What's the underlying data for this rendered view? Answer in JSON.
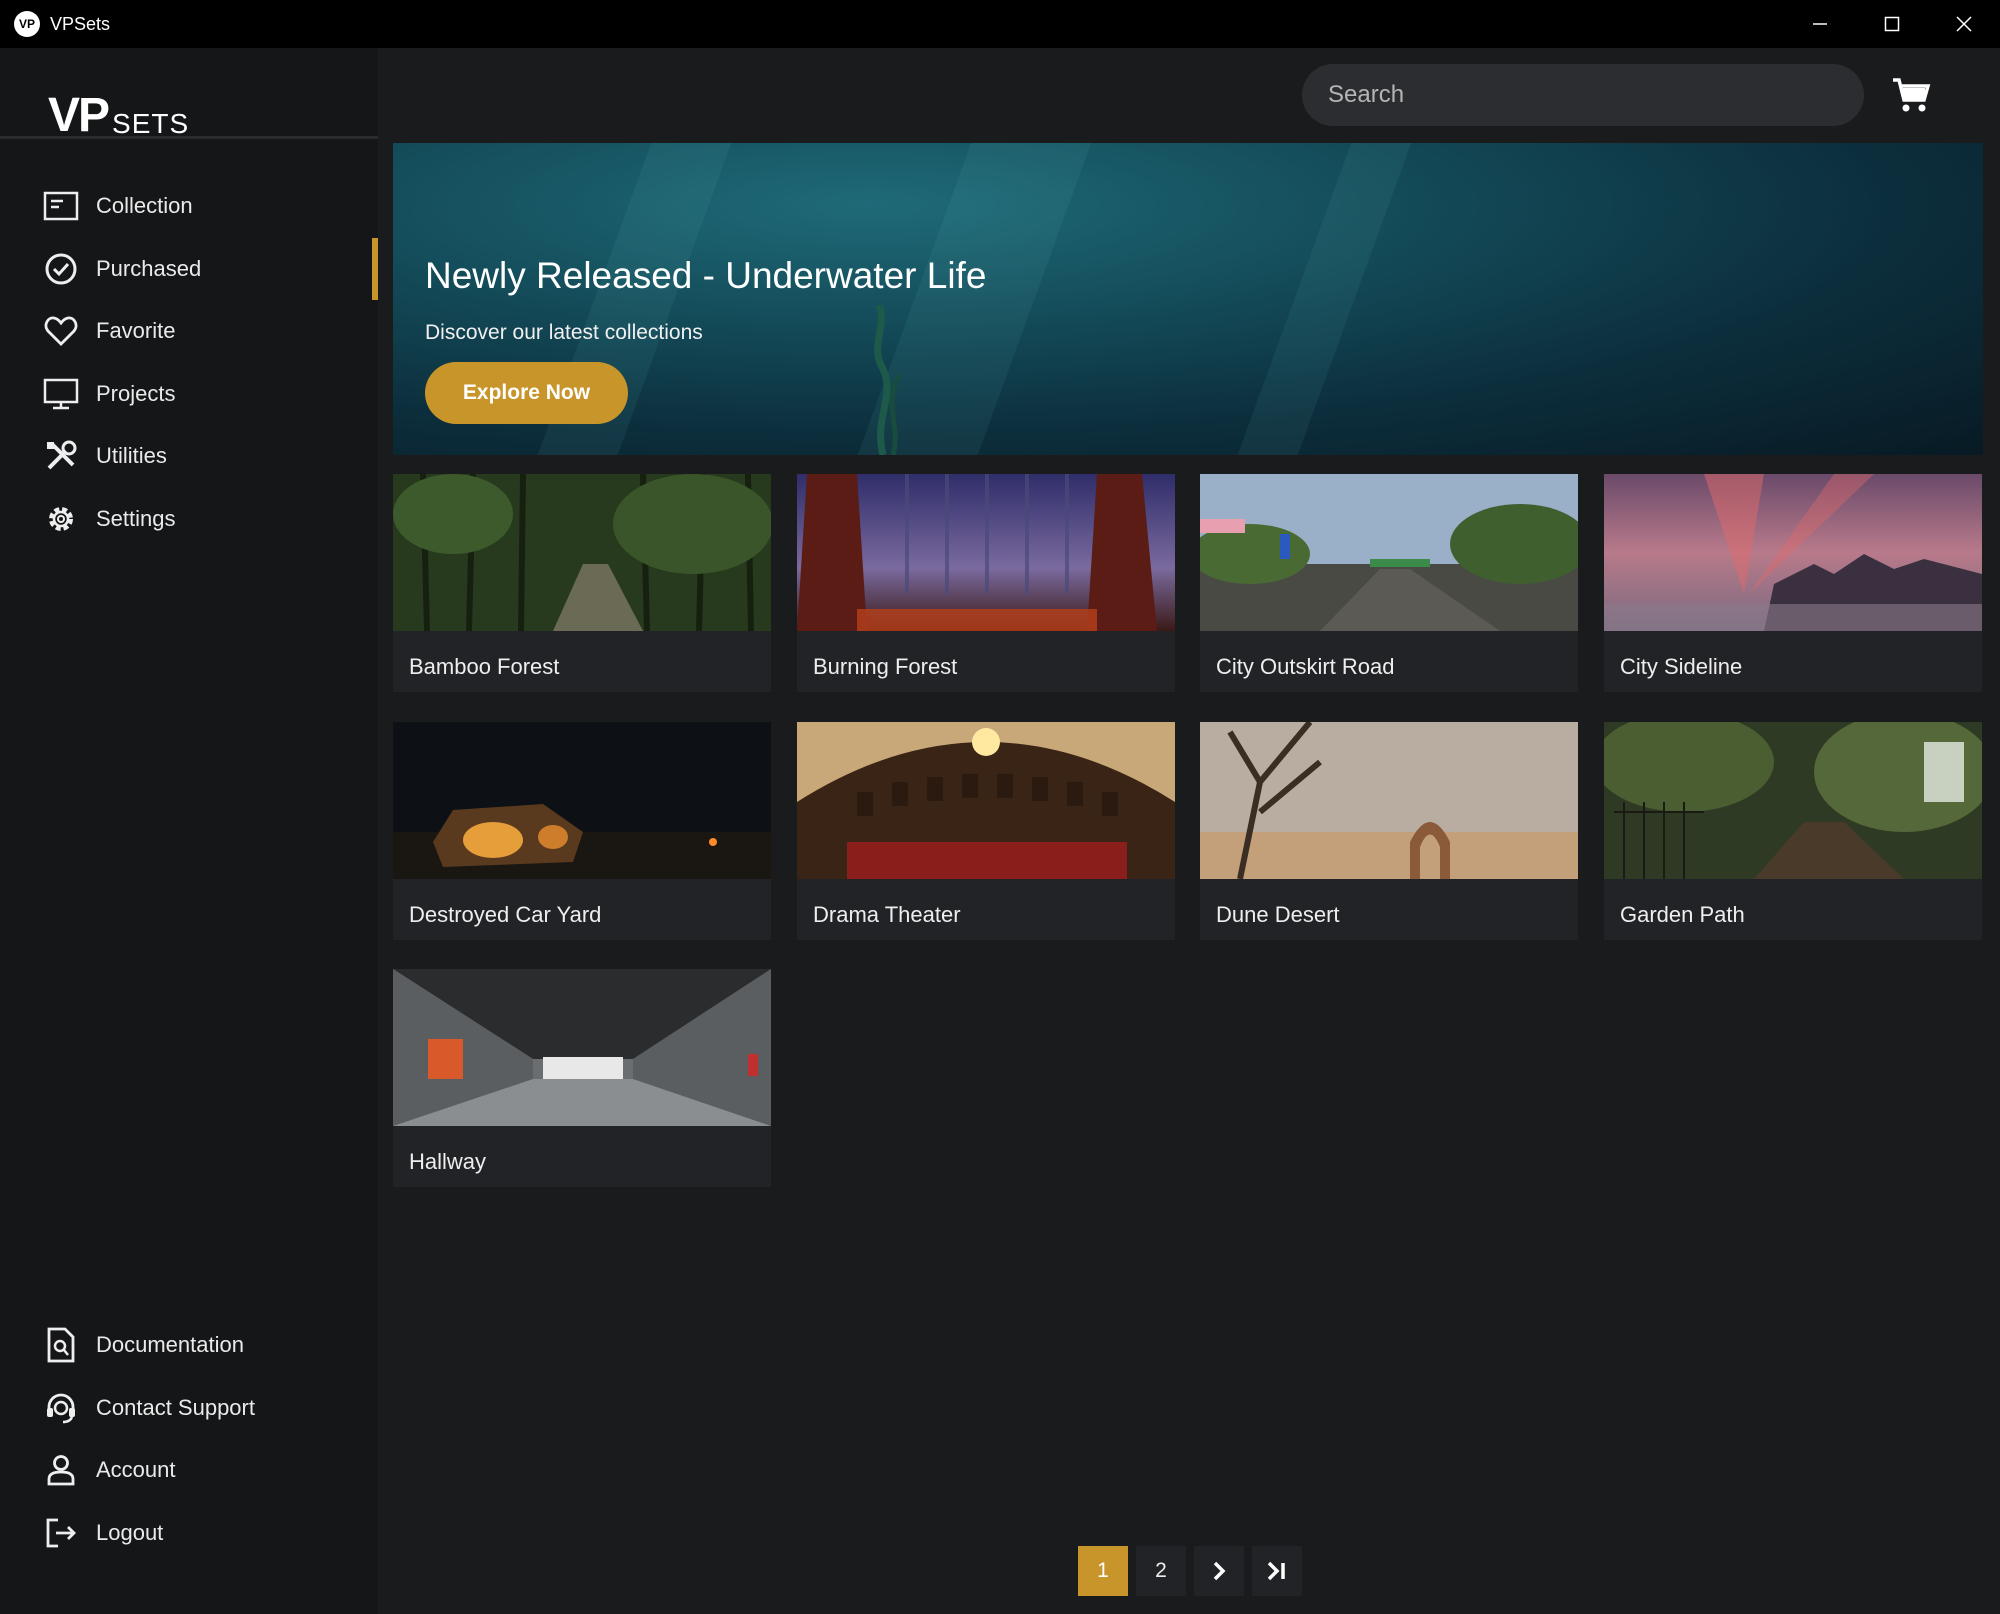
{
  "window": {
    "title": "VPSets",
    "icon_text": "VP"
  },
  "logo": {
    "main": "VP",
    "sub": "SETS"
  },
  "sidebar": {
    "items": [
      {
        "label": "Collection",
        "icon": "collection-icon"
      },
      {
        "label": "Purchased",
        "icon": "check-circle-icon",
        "active": true
      },
      {
        "label": "Favorite",
        "icon": "heart-icon"
      },
      {
        "label": "Projects",
        "icon": "monitor-icon"
      },
      {
        "label": "Utilities",
        "icon": "tools-icon"
      },
      {
        "label": "Settings",
        "icon": "gear-icon"
      }
    ],
    "bottom_items": [
      {
        "label": "Documentation",
        "icon": "document-search-icon"
      },
      {
        "label": "Contact Support",
        "icon": "headset-icon"
      },
      {
        "label": "Account",
        "icon": "user-icon"
      },
      {
        "label": "Logout",
        "icon": "logout-icon"
      }
    ]
  },
  "search": {
    "placeholder": "Search"
  },
  "banner": {
    "title": "Newly Released - Underwater Life",
    "subtitle": "Discover our latest collections",
    "button": "Explore Now"
  },
  "cards": [
    {
      "name": "Bamboo Forest"
    },
    {
      "name": "Burning Forest"
    },
    {
      "name": "City Outskirt Road"
    },
    {
      "name": "City Sideline"
    },
    {
      "name": "Destroyed Car Yard"
    },
    {
      "name": "Drama Theater"
    },
    {
      "name": "Dune Desert"
    },
    {
      "name": "Garden Path"
    },
    {
      "name": "Hallway"
    }
  ],
  "pagination": {
    "pages": [
      "1",
      "2"
    ],
    "current": "1"
  },
  "colors": {
    "accent": "#c8952a",
    "sidebar": "#151618",
    "content": "#1a1b1d",
    "card": "#222326"
  }
}
